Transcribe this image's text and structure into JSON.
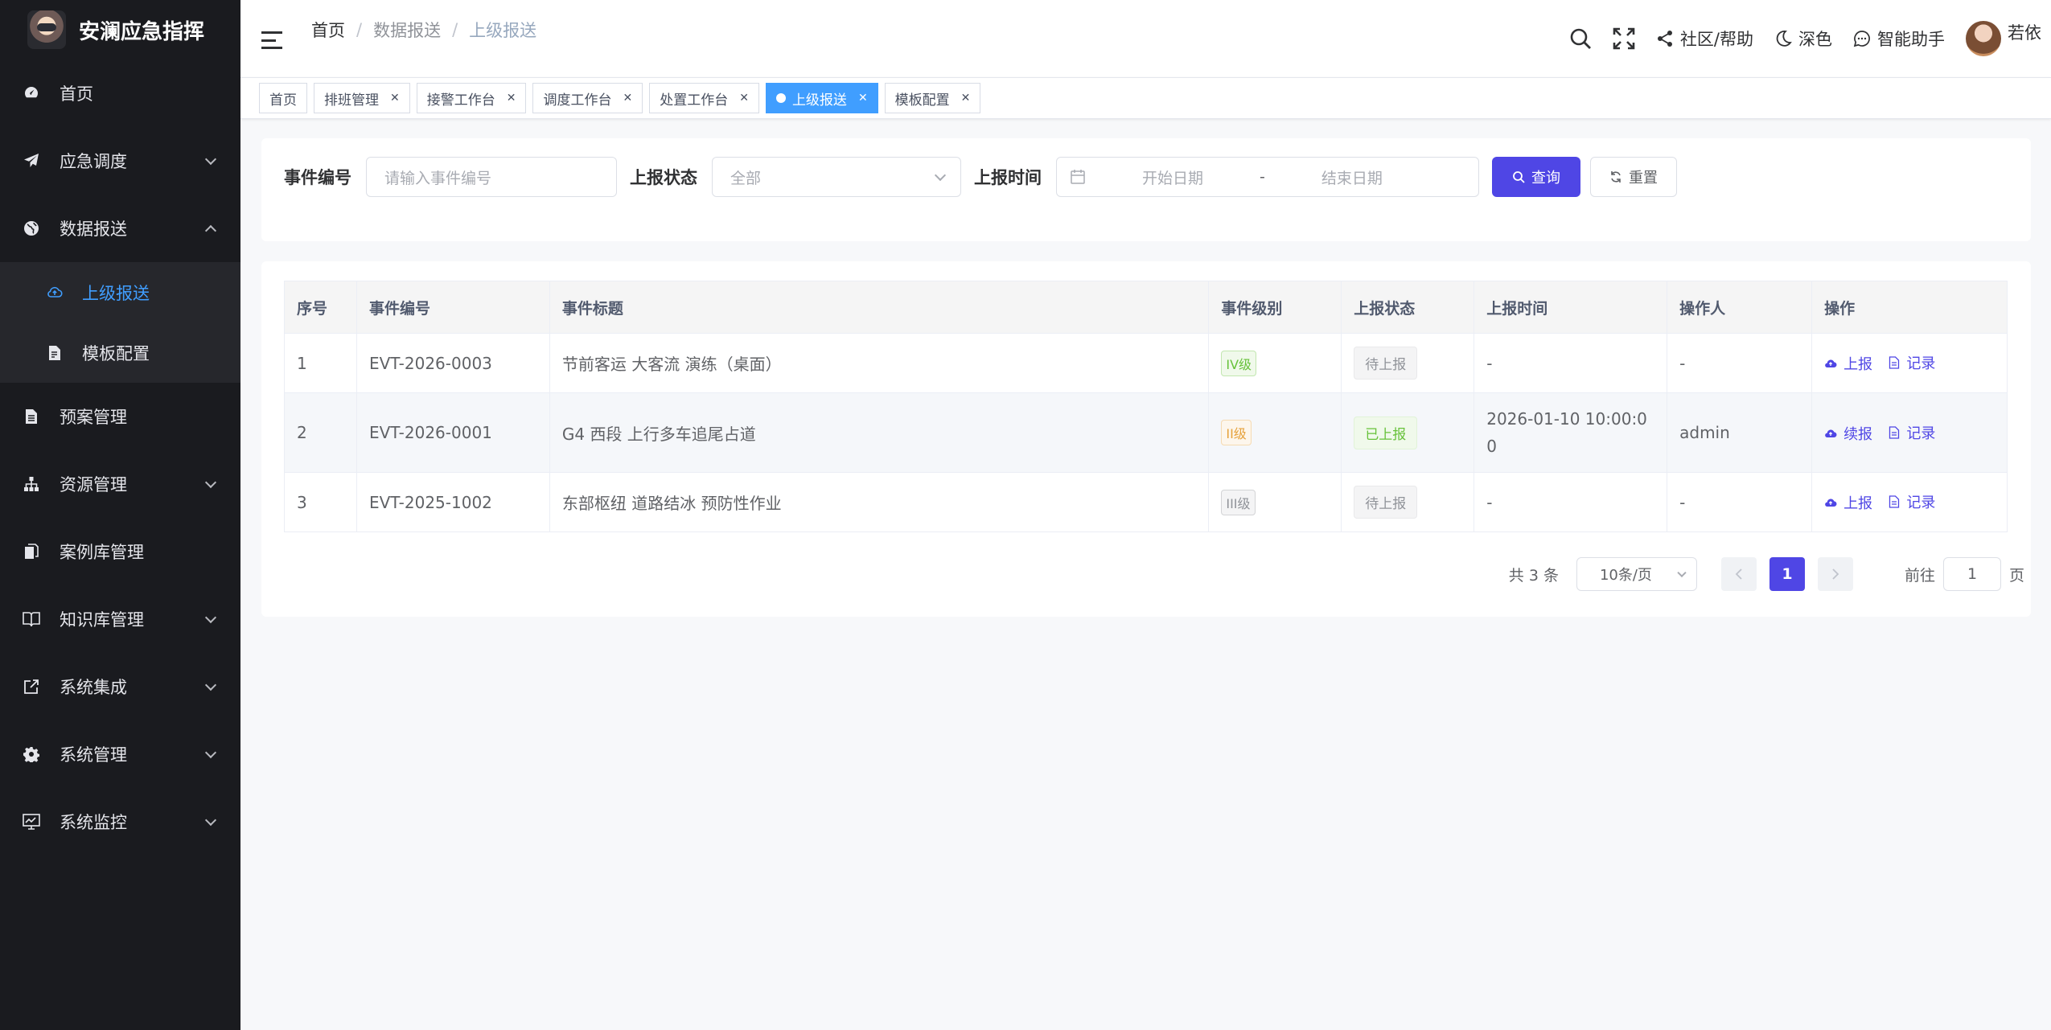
{
  "app": {
    "title": "安澜应急指挥"
  },
  "sidebar": {
    "items": [
      {
        "label": "首页",
        "icon": "dashboard-icon",
        "expandable": false
      },
      {
        "label": "应急调度",
        "icon": "send-icon",
        "expandable": true
      },
      {
        "label": "数据报送",
        "icon": "globe-icon",
        "expandable": true,
        "expanded": true,
        "children": [
          {
            "label": "上级报送",
            "icon": "cloud-upload-icon",
            "active": true
          },
          {
            "label": "模板配置",
            "icon": "document-edit-icon"
          }
        ]
      },
      {
        "label": "预案管理",
        "icon": "document-icon",
        "expandable": false
      },
      {
        "label": "资源管理",
        "icon": "org-tree-icon",
        "expandable": true
      },
      {
        "label": "案例库管理",
        "icon": "files-icon",
        "expandable": false
      },
      {
        "label": "知识库管理",
        "icon": "book-icon",
        "expandable": true
      },
      {
        "label": "系统集成",
        "icon": "external-link-icon",
        "expandable": true
      },
      {
        "label": "系统管理",
        "icon": "gear-icon",
        "expandable": true
      },
      {
        "label": "系统监控",
        "icon": "monitor-icon",
        "expandable": true
      }
    ]
  },
  "header": {
    "breadcrumb": [
      "首页",
      "数据报送",
      "上级报送"
    ],
    "tools": {
      "community": "社区/帮助",
      "theme": "深色",
      "assistant": "智能助手",
      "username": "若依"
    }
  },
  "tags": [
    {
      "label": "首页",
      "closable": false,
      "active": false
    },
    {
      "label": "排班管理",
      "closable": true,
      "active": false
    },
    {
      "label": "接警工作台",
      "closable": true,
      "active": false
    },
    {
      "label": "调度工作台",
      "closable": true,
      "active": false
    },
    {
      "label": "处置工作台",
      "closable": true,
      "active": false
    },
    {
      "label": "上级报送",
      "closable": true,
      "active": true
    },
    {
      "label": "模板配置",
      "closable": true,
      "active": false
    }
  ],
  "search": {
    "event_no_label": "事件编号",
    "event_no_placeholder": "请输入事件编号",
    "status_label": "上报状态",
    "status_value": "全部",
    "time_label": "上报时间",
    "start_placeholder": "开始日期",
    "range_sep": "-",
    "end_placeholder": "结束日期",
    "query_label": "查询",
    "reset_label": "重置"
  },
  "table": {
    "columns": [
      "序号",
      "事件编号",
      "事件标题",
      "事件级别",
      "上报状态",
      "上报时间",
      "操作人",
      "操作"
    ],
    "rows": [
      {
        "index": "1",
        "event_no": "EVT-2026-0003",
        "title": "节前客运 大客流 演练（桌面）",
        "level": "IV级",
        "level_color": "#67c23a",
        "status": "待上报",
        "time": "-",
        "operator": "-",
        "action1": "上报",
        "action2": "记录"
      },
      {
        "index": "2",
        "event_no": "EVT-2026-0001",
        "title": "G4 西段 上行多车追尾占道",
        "level": "II级",
        "level_color": "#e6a23c",
        "status": "已上报",
        "time": "2026-01-10 10:00:0 0",
        "operator": "admin",
        "action1": "续报",
        "action2": "记录"
      },
      {
        "index": "3",
        "event_no": "EVT-2025-1002",
        "title": "东部枢纽 道路结冰 预防性作业",
        "level": "III级",
        "level_color": "#909399",
        "status": "待上报",
        "time": "-",
        "operator": "-",
        "action1": "上报",
        "action2": "记录"
      }
    ]
  },
  "pagination": {
    "total": "共 3 条",
    "page_size": "10条/页",
    "current_page": "1",
    "goto_prefix": "前往",
    "goto_value": "1",
    "goto_suffix": "页"
  },
  "colors": {
    "accent": "#4f46e5",
    "tag_active": "#409eff",
    "sidebar_bg": "#1a1b1f"
  }
}
